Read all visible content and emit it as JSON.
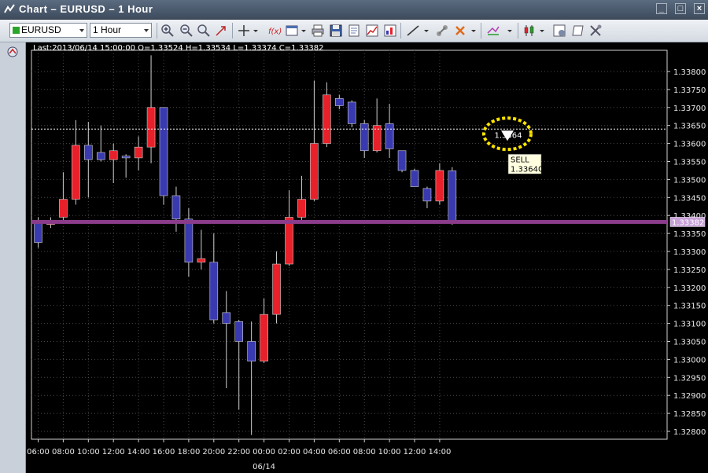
{
  "window": {
    "title": "Chart – EURUSD – 1 Hour",
    "buttons": [
      "_",
      "□",
      "×"
    ]
  },
  "toolbar": {
    "symbol": "EURUSD",
    "timeframe": "1 Hour",
    "tools": [
      "zoom-in-icon",
      "zoom-out-icon",
      "zoom-reset-icon",
      "cursor-icon",
      "crosshair-icon",
      "indicator-icon",
      "template-icon",
      "print-icon",
      "save-icon",
      "properties-icon",
      "chart-type-icon",
      "draw-line-icon",
      "fibonacci-icon",
      "delete-drawing-icon",
      "order-icon",
      "candle-icon",
      "settings-icon",
      "notes-icon",
      "tools-icon"
    ]
  },
  "info": {
    "last_line": "Last:2013/06/14 15:00:00 O=1.33524 H=1.33534 L=1.33374 C=1.33382"
  },
  "colors": {
    "background": "#000000",
    "bull_candle": "#e8202a",
    "bear_candle": "#3a3ab0",
    "wick": "#cfcfcf",
    "current_line": "#8a3c8a",
    "grid": "#4a4a4a",
    "order_line": "#ffffff",
    "marker_ring": "#ffe400"
  },
  "chart_data": {
    "type": "candlestick",
    "symbol": "EURUSD",
    "timeframe": "1 Hour",
    "ylim": [
      1.3278,
      1.3382
    ],
    "y_ticks": [
      "1.33800",
      "1.33750",
      "1.33700",
      "1.33650",
      "1.33600",
      "1.33550",
      "1.33500",
      "1.33450",
      "1.33400",
      "1.33350",
      "1.33300",
      "1.33250",
      "1.33200",
      "1.33150",
      "1.33100",
      "1.33050",
      "1.33000",
      "1.32950",
      "1.32900",
      "1.32850",
      "1.32800"
    ],
    "x_ticks": [
      "06:00",
      "08:00",
      "10:00",
      "12:00",
      "14:00",
      "16:00",
      "18:00",
      "20:00",
      "22:00",
      "00:00",
      "02:00",
      "04:00",
      "06:00",
      "08:00",
      "10:00",
      "12:00",
      "14:00"
    ],
    "date_label": "06/14",
    "candles": [
      {
        "o": 1.3338,
        "h": 1.33395,
        "l": 1.3331,
        "c": 1.33325
      },
      {
        "o": 1.33375,
        "h": 1.33395,
        "l": 1.33365,
        "c": 1.33385
      },
      {
        "o": 1.33395,
        "h": 1.3352,
        "l": 1.3338,
        "c": 1.33445
      },
      {
        "o": 1.33445,
        "h": 1.33665,
        "l": 1.3343,
        "c": 1.33595
      },
      {
        "o": 1.33595,
        "h": 1.3366,
        "l": 1.3345,
        "c": 1.33555
      },
      {
        "o": 1.33575,
        "h": 1.3365,
        "l": 1.3355,
        "c": 1.33555
      },
      {
        "o": 1.33555,
        "h": 1.336,
        "l": 1.3349,
        "c": 1.3358
      },
      {
        "o": 1.33565,
        "h": 1.3357,
        "l": 1.33505,
        "c": 1.3356
      },
      {
        "o": 1.3356,
        "h": 1.3362,
        "l": 1.33525,
        "c": 1.3359
      },
      {
        "o": 1.3359,
        "h": 1.33845,
        "l": 1.33545,
        "c": 1.337
      },
      {
        "o": 1.337,
        "h": 1.337,
        "l": 1.3343,
        "c": 1.33455
      },
      {
        "o": 1.33455,
        "h": 1.3348,
        "l": 1.33355,
        "c": 1.3339
      },
      {
        "o": 1.3339,
        "h": 1.3342,
        "l": 1.3323,
        "c": 1.3327
      },
      {
        "o": 1.3327,
        "h": 1.3336,
        "l": 1.3325,
        "c": 1.3328
      },
      {
        "o": 1.3327,
        "h": 1.3335,
        "l": 1.331,
        "c": 1.3311
      },
      {
        "o": 1.3313,
        "h": 1.3319,
        "l": 1.3292,
        "c": 1.331
      },
      {
        "o": 1.33105,
        "h": 1.3311,
        "l": 1.3286,
        "c": 1.3305
      },
      {
        "o": 1.3305,
        "h": 1.33105,
        "l": 1.3279,
        "c": 1.32995
      },
      {
        "o": 1.32995,
        "h": 1.3317,
        "l": 1.3299,
        "c": 1.33125
      },
      {
        "o": 1.33125,
        "h": 1.333,
        "l": 1.331,
        "c": 1.33265
      },
      {
        "o": 1.33265,
        "h": 1.3347,
        "l": 1.3326,
        "c": 1.33395
      },
      {
        "o": 1.33395,
        "h": 1.3351,
        "l": 1.3338,
        "c": 1.33445
      },
      {
        "o": 1.33445,
        "h": 1.33775,
        "l": 1.3344,
        "c": 1.336
      },
      {
        "o": 1.336,
        "h": 1.3377,
        "l": 1.3359,
        "c": 1.33735
      },
      {
        "o": 1.33725,
        "h": 1.33735,
        "l": 1.33695,
        "c": 1.33705
      },
      {
        "o": 1.33715,
        "h": 1.3372,
        "l": 1.33645,
        "c": 1.33655
      },
      {
        "o": 1.33655,
        "h": 1.33665,
        "l": 1.3356,
        "c": 1.3358
      },
      {
        "o": 1.3358,
        "h": 1.33725,
        "l": 1.33575,
        "c": 1.3365
      },
      {
        "o": 1.33655,
        "h": 1.3371,
        "l": 1.3356,
        "c": 1.33585
      },
      {
        "o": 1.3358,
        "h": 1.3358,
        "l": 1.3352,
        "c": 1.33525
      },
      {
        "o": 1.33525,
        "h": 1.3353,
        "l": 1.3348,
        "c": 1.3348
      },
      {
        "o": 1.33475,
        "h": 1.3348,
        "l": 1.3342,
        "c": 1.3344
      },
      {
        "o": 1.3344,
        "h": 1.33545,
        "l": 1.3343,
        "c": 1.33525
      },
      {
        "o": 1.33524,
        "h": 1.33534,
        "l": 1.33374,
        "c": 1.33382
      }
    ],
    "current_price": "1.33382",
    "order": {
      "side": "SELL",
      "price": "1.33640",
      "marker_text": "1.3364"
    }
  }
}
